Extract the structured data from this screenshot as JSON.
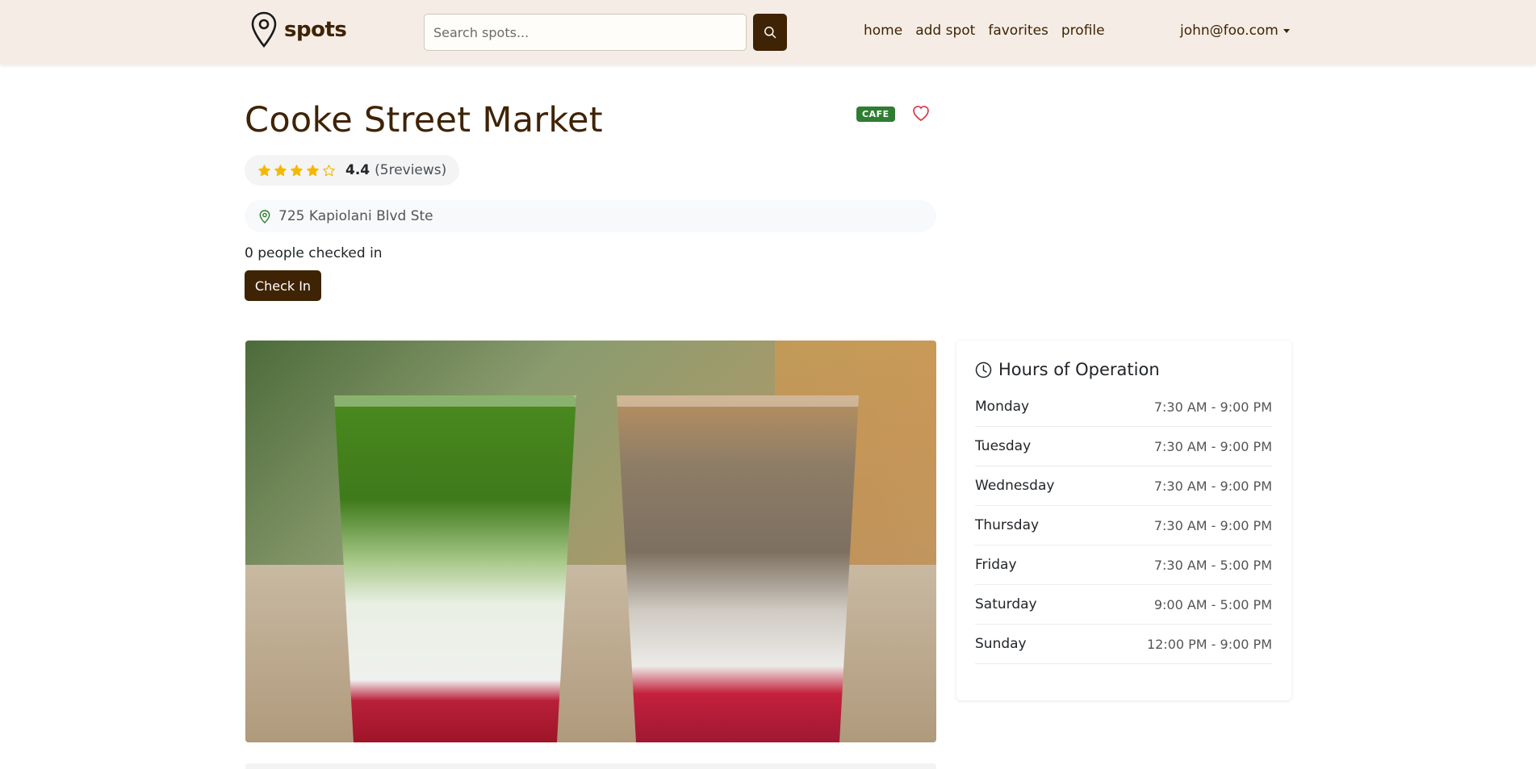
{
  "navbar": {
    "brand": "spots",
    "search_placeholder": "Search spots...",
    "links": [
      "home",
      "add spot",
      "favorites",
      "profile"
    ],
    "user_email": "john@foo.com"
  },
  "spot": {
    "title": "Cooke Street Market",
    "category": "CAFE",
    "rating": {
      "value": "4.4",
      "count_text": "(5reviews)",
      "stars_filled": 4,
      "stars_total": 5
    },
    "address": "725 Kapiolani Blvd Ste",
    "checkin_text": "0 people checked in",
    "checkin_button": "Check In"
  },
  "hours": {
    "title": "Hours of Operation",
    "days": [
      {
        "day": "Monday",
        "time": "7:30 AM - 9:00 PM"
      },
      {
        "day": "Tuesday",
        "time": "7:30 AM - 9:00 PM"
      },
      {
        "day": "Wednesday",
        "time": "7:30 AM - 9:00 PM"
      },
      {
        "day": "Thursday",
        "time": "7:30 AM - 9:00 PM"
      },
      {
        "day": "Friday",
        "time": "7:30 AM - 5:00 PM"
      },
      {
        "day": "Saturday",
        "time": "9:00 AM - 5:00 PM"
      },
      {
        "day": "Sunday",
        "time": "12:00 PM - 9:00 PM"
      }
    ]
  },
  "colors": {
    "brand": "#3f2305",
    "navbar_bg": "#f5ede5",
    "badge_green": "#2e7d32",
    "star": "#f5b800",
    "heart": "#dc3545"
  },
  "icons": {
    "brand": "map-pin-icon",
    "search": "search-icon",
    "favorite": "heart-icon",
    "address": "location-pin-icon",
    "hours": "clock-icon",
    "star": "star-icon"
  }
}
